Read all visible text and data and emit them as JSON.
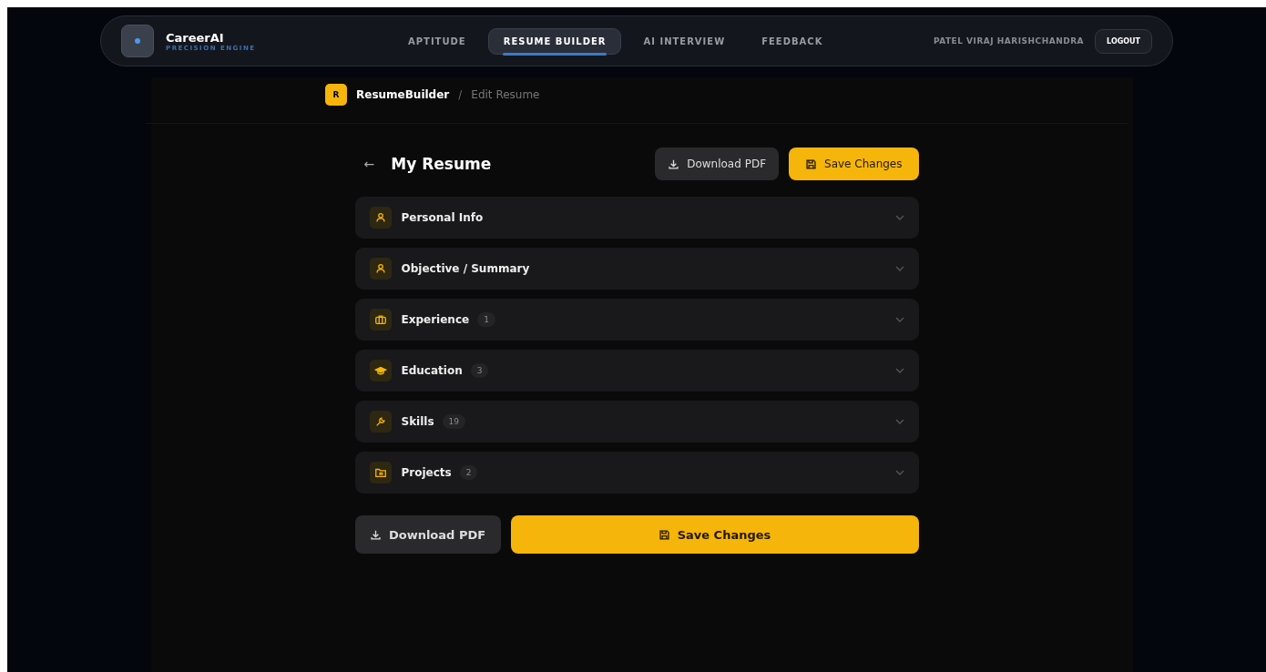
{
  "brand": {
    "name": "CareerAI",
    "tagline": "PRECISION ENGINE"
  },
  "nav": [
    {
      "label": "APTITUDE",
      "selected": false
    },
    {
      "label": "RESUME BUILDER",
      "selected": true
    },
    {
      "label": "AI INTERVIEW",
      "selected": false
    },
    {
      "label": "FEEDBACK",
      "selected": false
    }
  ],
  "user": {
    "name": "PATEL VIRAJ HARISHCHANDRA",
    "logout": "LOGOUT"
  },
  "breadcrumb": {
    "badge": "R",
    "app": "ResumeBuilder",
    "separator": "/",
    "page": "Edit Resume"
  },
  "editor": {
    "back": "←",
    "title": "My Resume",
    "download": "Download PDF",
    "save": "Save Changes"
  },
  "sections": [
    {
      "kind": "person",
      "label": "Personal Info",
      "expanded": false
    },
    {
      "kind": "person",
      "label": "Objective / Summary",
      "expanded": false
    },
    {
      "kind": "briefcase",
      "label": "Experience",
      "count": "1",
      "expanded": false
    },
    {
      "kind": "cap",
      "label": "Education",
      "count": "3",
      "expanded": false
    },
    {
      "kind": "wrench",
      "label": "Skills",
      "count": "19",
      "expanded": false
    },
    {
      "kind": "folder",
      "label": "Projects",
      "count": "2",
      "expanded": false
    }
  ],
  "footer": {
    "download": "Download PDF",
    "save": "Save Changes"
  }
}
